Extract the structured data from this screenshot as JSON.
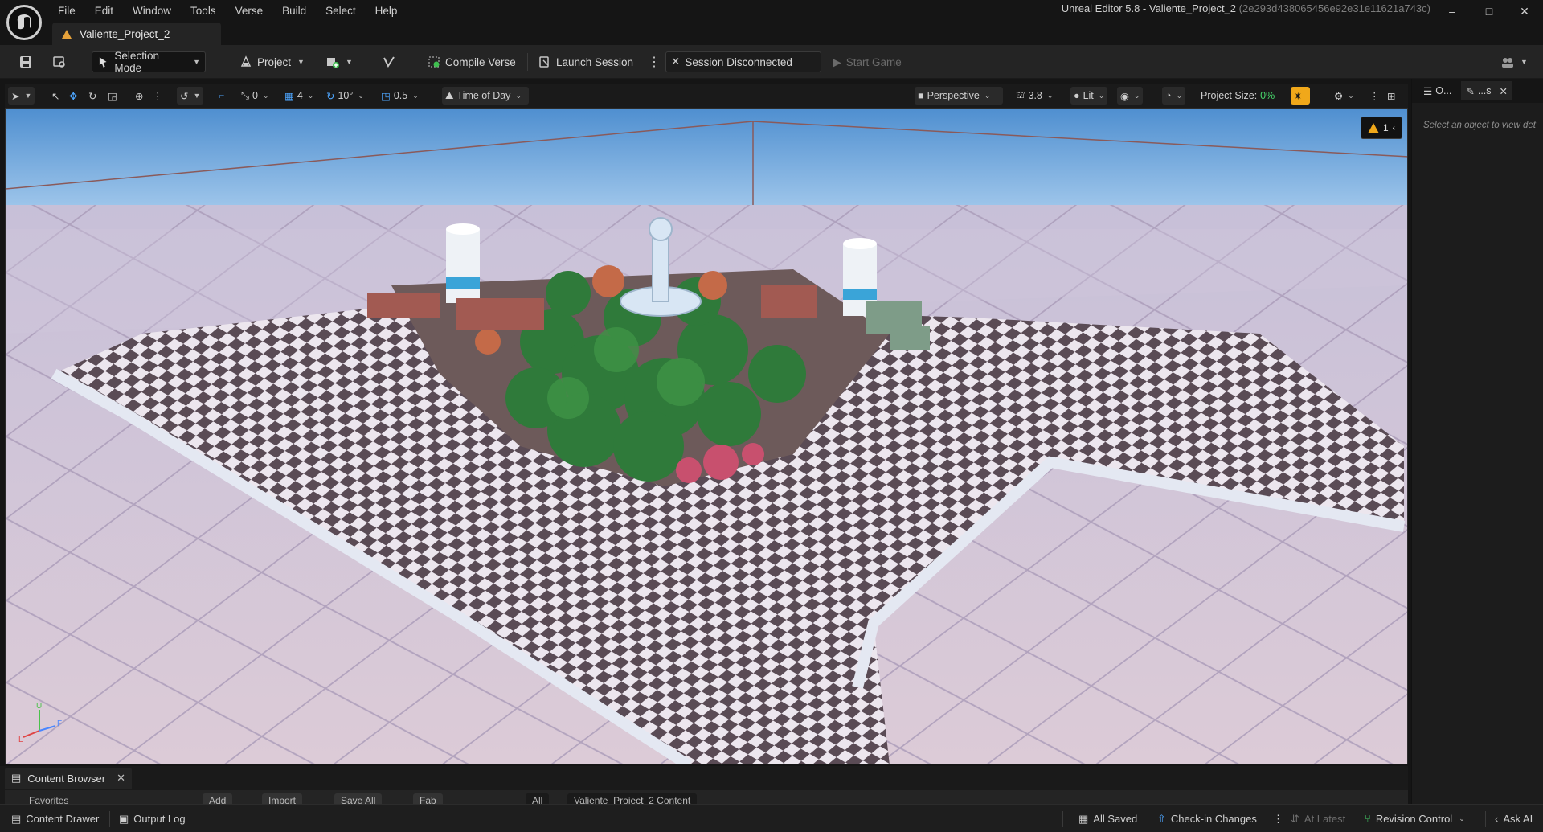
{
  "window": {
    "title": "Unreal Editor 5.8 - Valiente_Project_2",
    "hash": "(2e293d438065456e92e31e11621a743c)",
    "minimize": "–",
    "maximize": "□",
    "close": "✕"
  },
  "menu": [
    "File",
    "Edit",
    "Window",
    "Tools",
    "Verse",
    "Build",
    "Select",
    "Help"
  ],
  "document_tab": "Valiente_Project_2",
  "toolbar": {
    "selection_mode": "Selection Mode",
    "project": "Project",
    "compile_verse": "Compile Verse",
    "launch_session": "Launch Session",
    "session_status": "Session Disconnected",
    "start_game": "Start Game"
  },
  "viewport_toolbar": {
    "rotation_snap_value": "0",
    "grid_value": "4",
    "angle_snap_value": "10°",
    "scale_snap_value": "0.5",
    "time_of_day": "Time of Day",
    "perspective": "Perspective",
    "camera_speed": "3.8",
    "lit": "Lit",
    "project_size_label": "Project Size:",
    "project_size_value": "0%"
  },
  "viewport": {
    "warning_count": "1",
    "axis_labels": {
      "z": "U",
      "x": "L",
      "y": "F"
    }
  },
  "details_panel": {
    "tab_outliner": "O...",
    "tab_details": "...s",
    "empty_message": "Select an object to view det"
  },
  "content_browser": {
    "tab_label": "Content Browser",
    "favorites_label": "Favorites",
    "add_label": "Add",
    "import_label": "Import",
    "save_all_label": "Save All",
    "fab_label": "Fab",
    "path_all": "All",
    "path_content": "Valiente_Project_2 Content"
  },
  "statusbar": {
    "content_drawer": "Content Drawer",
    "output_log": "Output Log",
    "all_saved": "All Saved",
    "check_in": "Check-in Changes",
    "at_latest": "At Latest",
    "revision_control": "Revision Control",
    "ask_ai": "Ask AI"
  },
  "colors": {
    "accent_orange": "#f0a81a",
    "project_size_green": "#46d46a",
    "sky": "#7fb2e0",
    "ground": "#d8c8d8"
  }
}
